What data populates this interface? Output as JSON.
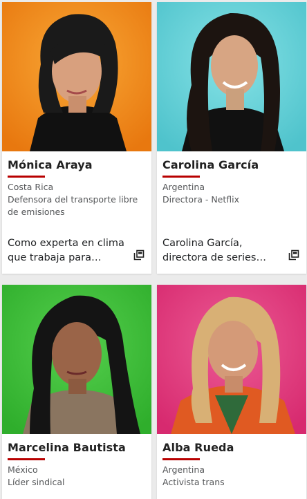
{
  "cards": [
    {
      "name": "Mónica Araya",
      "country": "Costa Rica",
      "role": "Defensora del transporte libre de emisiones",
      "teaser_line1": "Como experta en clima",
      "teaser_line2": "que trabaja para…",
      "bg_color": "#f08a1c"
    },
    {
      "name": "Carolina García",
      "country": "Argentina",
      "role": "Directora - Netflix",
      "teaser_line1": "Carolina García,",
      "teaser_line2": "directora de series…",
      "bg_color": "#5fd0d8"
    },
    {
      "name": "Marcelina Bautista",
      "country": "México",
      "role": "Líder sindical",
      "bg_color": "#3dbd3a"
    },
    {
      "name": "Alba Rueda",
      "country": "Argentina",
      "role": "Activista trans",
      "bg_color": "#e0357a"
    }
  ],
  "icons": {
    "external_link": "external-link-icon"
  },
  "accent_color": "#b80000"
}
